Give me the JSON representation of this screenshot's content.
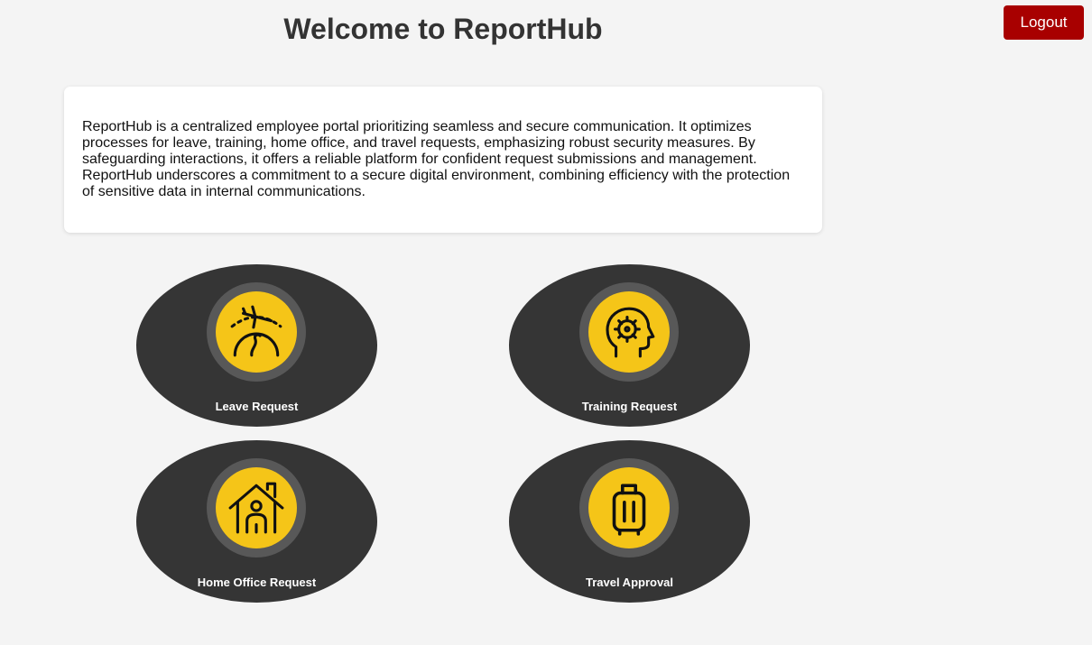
{
  "header": {
    "title": "Welcome to ReportHub",
    "logout_label": "Logout"
  },
  "intro": {
    "text": "ReportHub is a centralized employee portal prioritizing seamless and secure communication. It optimizes processes for leave, training, home office, and travel requests, emphasizing robust security measures. By safeguarding interactions, it offers a reliable platform for confident request submissions and management. ReportHub underscores a commitment to a secure digital environment, combining efficiency with the protection of sensitive data in internal communications."
  },
  "tiles": [
    {
      "label": "Leave Request",
      "icon": "globe-airplane-icon"
    },
    {
      "label": "Training Request",
      "icon": "head-gear-icon"
    },
    {
      "label": "Home Office Request",
      "icon": "house-person-icon"
    },
    {
      "label": "Travel Approval",
      "icon": "suitcase-icon"
    }
  ],
  "colors": {
    "background": "#f4f4f4",
    "logout": "#a80000",
    "tile": "#353535",
    "ring": "#585858",
    "accent": "#f5c518"
  }
}
